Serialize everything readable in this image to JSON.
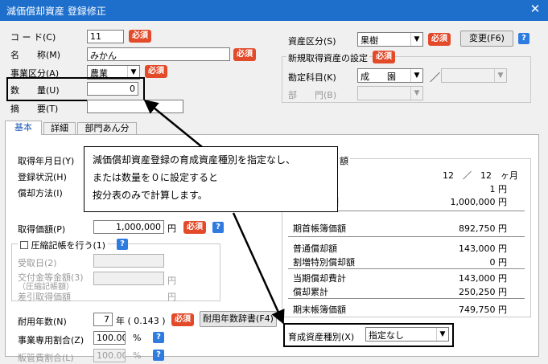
{
  "window": {
    "title": "減価償却資産 登録修正",
    "close": "✕"
  },
  "form": {
    "code_label": "コ ー ド(C)",
    "code_value": "11",
    "name_label": "名　　称(M)",
    "name_value": "みかん",
    "biz_label": "事業区分(A)",
    "biz_value": "農業",
    "qty_label": "数　　量(U)",
    "qty_value": "0",
    "summary_label": "摘　　要(T)",
    "required": "必須",
    "help": "?"
  },
  "right": {
    "asset_label": "資産区分(S)",
    "asset_value": "果樹",
    "change_button": "変更(F6)",
    "group_title": "新規取得資産の設定",
    "account_label": "勘定科目(K)",
    "account_value": "成　　園",
    "slash": "／",
    "dept_label": "部　　門(B)"
  },
  "tabs": [
    {
      "label": "基本"
    },
    {
      "label": "詳細"
    },
    {
      "label": "部門あん分"
    }
  ],
  "basic": {
    "acq_date": "取得年月日(Y)",
    "reg_status": "登録状況(H)",
    "method": "償却方法(I)",
    "acq_price_label": "取得価額(P)",
    "acq_price_value": "1,000,000",
    "yen": "円",
    "compress_label": "圧縮記帳を行う(1)",
    "received_date": "受取日(2)",
    "grant_label1": "交付金等金額(3)",
    "grant_label2": "（圧縮記帳額）",
    "net_price": "差引取得価額",
    "life_label": "耐用年数(N)",
    "life_value": "7",
    "life_rate": "年 ( 0.143 )",
    "life_button": "耐用年数辞書(F4)",
    "biz_ratio_label": "事業専用割合(Z)",
    "biz_ratio_value": "100.00",
    "pct": "%",
    "sales_ratio_label": "販管費割合(L)",
    "sales_ratio_value": "100.00"
  },
  "summary": {
    "header_fragment": "額",
    "months": "12　／　12　ヶ月",
    "row_1": "1 円",
    "row_2_label": "額",
    "row_2_value": "1,000,000 円",
    "opening_label": "期首帳簿価額",
    "opening_value": "892,750 円",
    "normal_label": "普通償却額",
    "normal_value": "143,000 円",
    "special_label": "割増特別償却額",
    "special_value": "0 円",
    "current_label": "当期償却費計",
    "current_value": "143,000 円",
    "accum_label": "償却累計",
    "accum_value": "250,250 円",
    "closing_label": "期末帳簿価額",
    "closing_value": "749,750 円"
  },
  "growth": {
    "label": "育成資産種別(X)",
    "value": "指定なし"
  },
  "note": {
    "line1": "減価償却資産登録の育成資産種別を指定なし、",
    "line2": "または数量を０に設定すると",
    "line3": "按分表のみで計算します。"
  }
}
